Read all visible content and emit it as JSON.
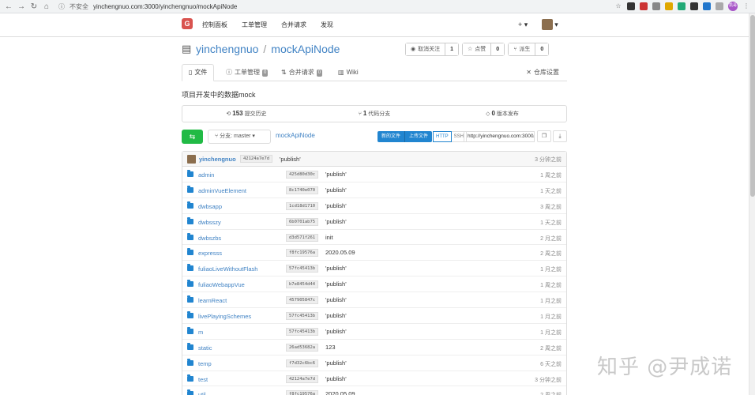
{
  "browser": {
    "insecure_label": "不安全",
    "url": "yinchengnuo.com:3000/yinchengnuo/mockApiNode",
    "profile_label": "凯哥"
  },
  "nav": {
    "logo": "G",
    "items": [
      "控制面板",
      "工单管理",
      "合并请求",
      "发现"
    ],
    "plus": "+ ▾",
    "user_caret": "▾"
  },
  "repo": {
    "owner": "yinchengnuo",
    "sep": "/",
    "name": "mockApiNode",
    "watch_label": "取消关注",
    "watch_count": "1",
    "star_label": "点赞",
    "star_count": "0",
    "fork_label": "派生",
    "fork_count": "0"
  },
  "tabs": {
    "files": "文件",
    "issues": "工单管理",
    "issues_count": "0",
    "pulls": "合并请求",
    "pulls_count": "0",
    "wiki": "Wiki",
    "settings": "仓库设置"
  },
  "description": "项目开发中的数据mock",
  "stats": {
    "commits_num": "153",
    "commits_label": "提交历史",
    "branches_num": "1",
    "branches_label": "代码分支",
    "releases_num": "0",
    "releases_label": "版本发布"
  },
  "toolbar": {
    "branch_label": "分支: master ▾",
    "crumb": "mockApiNode",
    "new_file": "新的文件",
    "upload_file": "上传文件",
    "http": "HTTP",
    "ssh": "SSH",
    "clone_url": "http://yinchengnuo.com:3000/yinchengnuo/mockApiNode.git"
  },
  "latest_commit": {
    "user": "yinchengnuo",
    "sha": "42124a7e7d",
    "message": "'publish'",
    "time": "3 分钟之前"
  },
  "files": [
    {
      "name": "admin",
      "sha": "425d80d30c",
      "msg": "'publish'",
      "time": "1 周之前"
    },
    {
      "name": "adminVueElement",
      "sha": "8c1740e070",
      "msg": "'publish'",
      "time": "1 天之前"
    },
    {
      "name": "dwbsapp",
      "sha": "1cd18d1710",
      "msg": "'publish'",
      "time": "3 周之前"
    },
    {
      "name": "dwbsszy",
      "sha": "6b0701ab75",
      "msg": "'publish'",
      "time": "1 天之前"
    },
    {
      "name": "dwbszbs",
      "sha": "d3d571f261",
      "msg": "init",
      "time": "2 月之前"
    },
    {
      "name": "expresss",
      "sha": "f8fc19576a",
      "msg": "2020.05.09",
      "time": "2 周之前"
    },
    {
      "name": "fuliaoLiveWithoutFlash",
      "sha": "57fc45413b",
      "msg": "'publish'",
      "time": "1 月之前"
    },
    {
      "name": "fuliaoWebappVue",
      "sha": "b7e8454d44",
      "msg": "'publish'",
      "time": "1 周之前"
    },
    {
      "name": "learnReact",
      "sha": "457905847c",
      "msg": "'publish'",
      "time": "1 月之前"
    },
    {
      "name": "livePlayingSchemes",
      "sha": "57fc45413b",
      "msg": "'publish'",
      "time": "1 月之前"
    },
    {
      "name": "m",
      "sha": "57fc45413b",
      "msg": "'publish'",
      "time": "1 月之前"
    },
    {
      "name": "static",
      "sha": "26ad53682a",
      "msg": "123",
      "time": "2 周之前"
    },
    {
      "name": "temp",
      "sha": "f7d32c6bc6",
      "msg": "'publish'",
      "time": "6 天之前"
    },
    {
      "name": "test",
      "sha": "42124a7e7d",
      "msg": "'publish'",
      "time": "3 分钟之前"
    },
    {
      "name": "util",
      "sha": "f8fc19576a",
      "msg": "2020.05.09",
      "time": "2 周之前"
    }
  ],
  "watermark": "知乎 @尹成诺"
}
